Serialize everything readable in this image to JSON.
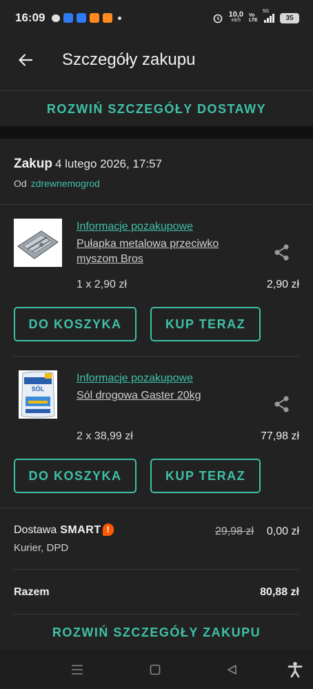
{
  "statusbar": {
    "time": "16:09",
    "net_speed": "10,0",
    "net_unit": "KB/S",
    "volte": "Vo LTE",
    "signal": "5G",
    "battery": "35"
  },
  "appbar": {
    "title": "Szczegóły zakupu"
  },
  "delivery_expand_label": "ROZWIŃ SZCZEGÓŁY DOSTAWY",
  "purchase": {
    "label": "Zakup",
    "date": "4 lutego 2026, 17:57",
    "seller_prefix": "Od",
    "seller_name": "zdrewnemogrod"
  },
  "items": [
    {
      "info_link": "Informacje pozakupowe",
      "title_line1": "Pułapka metalowa przeciwko",
      "title_line2": "myszom Bros",
      "qty": "1 x 2,90 zł",
      "price": "2,90 zł",
      "cart_button": "DO KOSZYKA",
      "buy_button": "KUP TERAZ"
    },
    {
      "info_link": "Informacje pozakupowe",
      "title_line1": "Sól drogowa Gaster 20kg",
      "qty": "2 x 38,99 zł",
      "price": "77,98 zł",
      "cart_button": "DO KOSZYKA",
      "buy_button": "KUP TERAZ",
      "bag_text": "SÓL"
    }
  ],
  "delivery": {
    "label": "Dostawa",
    "brand": "SMART",
    "brand_mark": "!",
    "carrier": "Kurier, DPD",
    "old_price": "29,98 zł",
    "price": "0,00 zł"
  },
  "total": {
    "label": "Razem",
    "value": "80,88 zł"
  },
  "purchase_expand_label": "ROZWIŃ SZCZEGÓŁY ZAKUPU",
  "colors": {
    "accent": "#3fc1a8",
    "background": "#222222",
    "smart_orange": "#ff5a00"
  }
}
